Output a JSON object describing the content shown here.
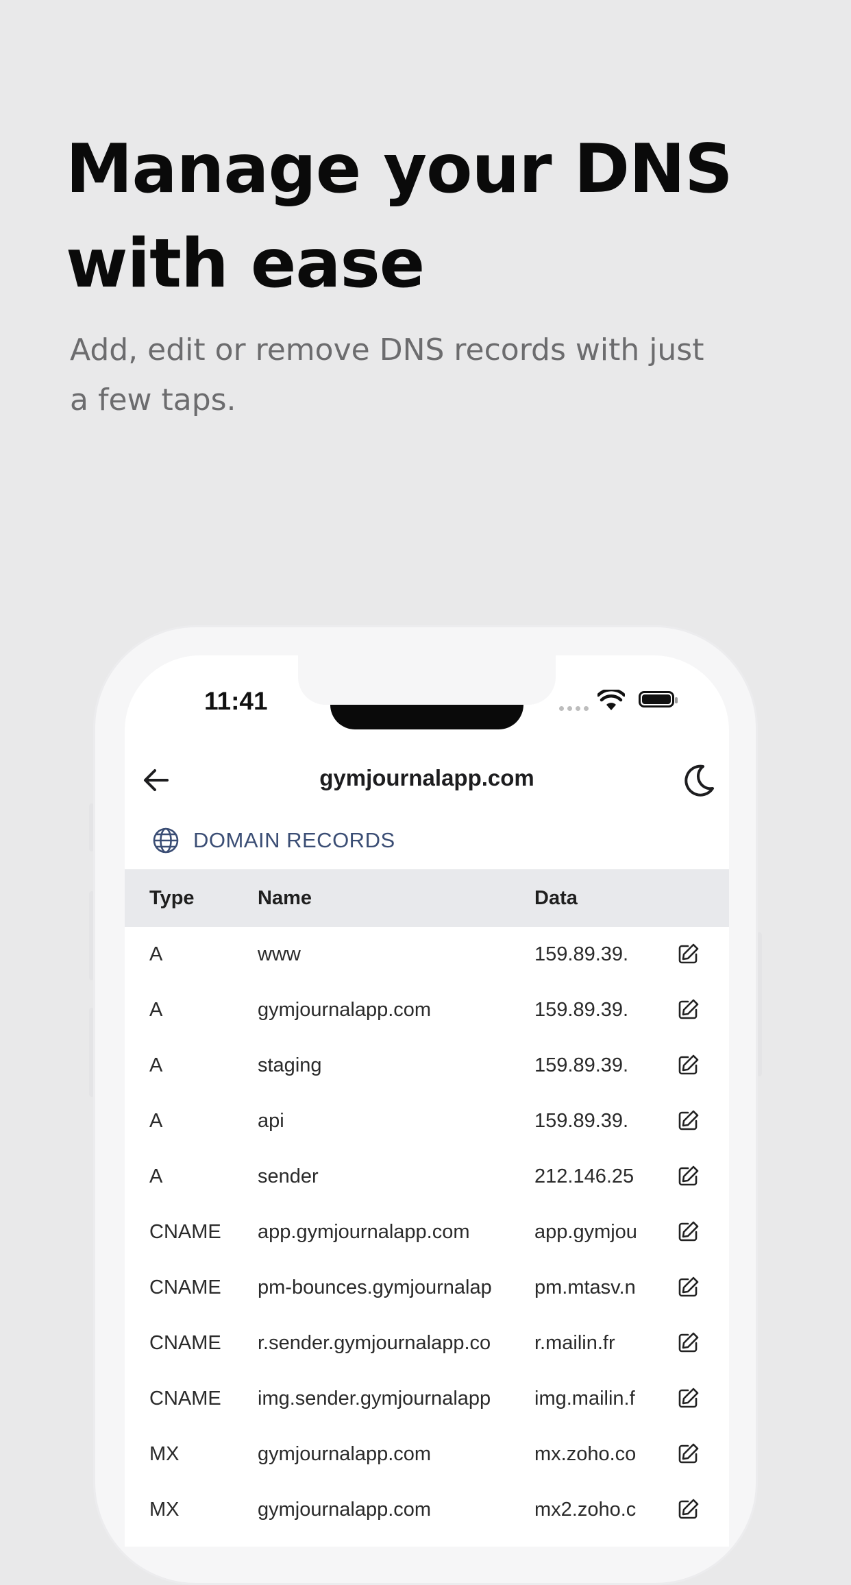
{
  "hero": {
    "title": "Manage your DNS with ease",
    "subtitle": "Add, edit or remove DNS records with just a few taps."
  },
  "status_bar": {
    "time": "11:41"
  },
  "app_bar": {
    "title": "gymjournalapp.com"
  },
  "section": {
    "label": "DOMAIN RECORDS"
  },
  "table": {
    "headers": {
      "type": "Type",
      "name": "Name",
      "data": "Data"
    },
    "rows": [
      {
        "type": "A",
        "name": "www",
        "data": "159.89.39."
      },
      {
        "type": "A",
        "name": "gymjournalapp.com",
        "data": "159.89.39."
      },
      {
        "type": "A",
        "name": "staging",
        "data": "159.89.39."
      },
      {
        "type": "A",
        "name": "api",
        "data": "159.89.39."
      },
      {
        "type": "A",
        "name": "sender",
        "data": "212.146.25"
      },
      {
        "type": "CNAME",
        "name": "app.gymjournalapp.com",
        "data": "app.gymjou"
      },
      {
        "type": "CNAME",
        "name": "pm-bounces.gymjournalap",
        "data": "pm.mtasv.n"
      },
      {
        "type": "CNAME",
        "name": "r.sender.gymjournalapp.co",
        "data": "r.mailin.fr"
      },
      {
        "type": "CNAME",
        "name": "img.sender.gymjournalapp",
        "data": "img.mailin.f"
      },
      {
        "type": "MX",
        "name": "gymjournalapp.com",
        "data": "mx.zoho.co"
      },
      {
        "type": "MX",
        "name": "gymjournalapp.com",
        "data": "mx2.zoho.c"
      }
    ]
  },
  "colors": {
    "background": "#e9e9ea",
    "accent_text": "#3a4d74",
    "table_header": "#e8e9ec"
  }
}
